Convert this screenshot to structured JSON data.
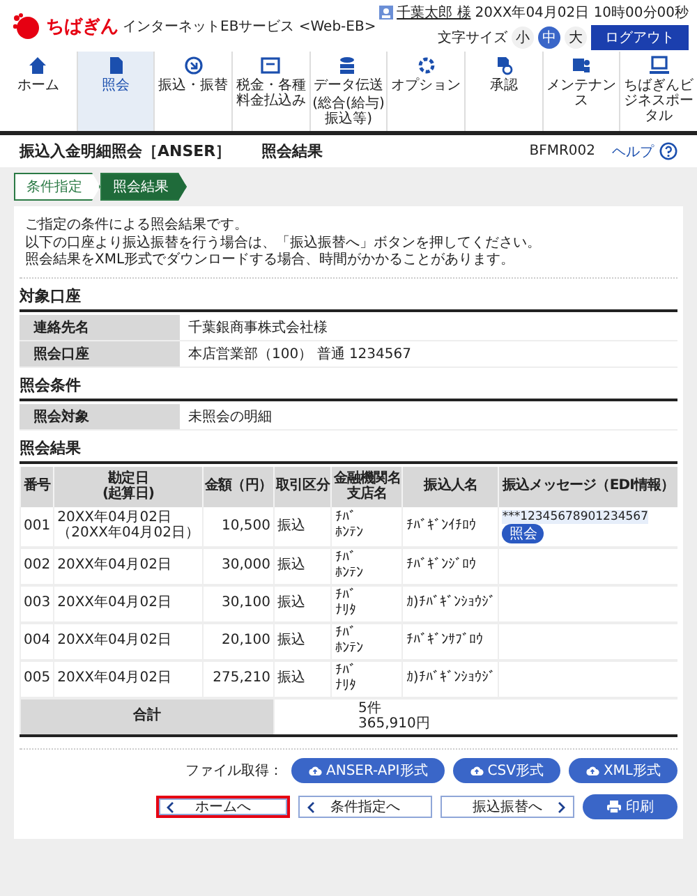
{
  "header": {
    "logo": "ちばぎん",
    "service": "インターネットEBサービス <Web-EB>",
    "user": "千葉太郎 様",
    "datetime": "20XX年04月02日 10時00分00秒",
    "font_size": {
      "label": "文字サイズ",
      "options": [
        {
          "label": "小",
          "selected": false
        },
        {
          "label": "中",
          "selected": true
        },
        {
          "label": "大",
          "selected": false
        }
      ]
    },
    "logout": "ログアウト"
  },
  "nav": [
    {
      "label": "ホーム",
      "selected": false
    },
    {
      "label": "照会",
      "selected": true
    },
    {
      "label": "振込・振替",
      "selected": false
    },
    {
      "label": "税金・各種料金払込み",
      "selected": false
    },
    {
      "label": "データ伝送",
      "sublabel": "(総合(給与)振込等)",
      "selected": false
    },
    {
      "label": "オプション",
      "selected": false
    },
    {
      "label": "承認",
      "selected": false
    },
    {
      "label": "メンテナンス",
      "selected": false
    },
    {
      "label": "ちばぎんビジネスポータル",
      "selected": false
    }
  ],
  "page": {
    "title": "振込入金明細照会［ANSER］",
    "subtitle": "照会結果",
    "screen_id": "BFMR002",
    "help": "ヘルプ"
  },
  "steps": [
    {
      "label": "条件指定",
      "selected": false
    },
    {
      "label": "照会結果",
      "selected": true
    }
  ],
  "intro": [
    "ご指定の条件による照会結果です。",
    "以下の口座より振込振替を行う場合は、「振込振替へ」ボタンを押してください。",
    "照会結果をXML形式でダウンロードする場合、時間がかかることがあります。"
  ],
  "target_account": {
    "title": "対象口座",
    "rows": [
      {
        "label": "連絡先名",
        "value": "千葉銀商事株式会社様"
      },
      {
        "label": "照会口座",
        "value": "本店営業部（100） 普通 1234567"
      }
    ]
  },
  "conditions": {
    "title": "照会条件",
    "rows": [
      {
        "label": "照会対象",
        "value": "未照会の明細"
      }
    ]
  },
  "results": {
    "title": "照会結果",
    "columns": [
      [
        "番号"
      ],
      [
        "勘定日",
        "(起算日)"
      ],
      [
        "金額（円）"
      ],
      [
        "取引区分"
      ],
      [
        "金融機関名",
        "支店名"
      ],
      [
        "振込人名"
      ],
      [
        "振込メッセージ（EDI情報）"
      ]
    ],
    "rows": [
      {
        "no": "001",
        "date": "20XX年04月02日",
        "date_sub": "（20XX年04月02日）",
        "amount": "10,500",
        "type": "振込",
        "bank": "ﾁﾊﾞ",
        "branch": "ﾎﾝﾃﾝ",
        "payer": "ﾁﾊﾞｷﾞﾝｲﾁﾛｳ",
        "message": "***12345678901234567",
        "message_button": "照会"
      },
      {
        "no": "002",
        "date": "20XX年04月02日",
        "amount": "30,000",
        "type": "振込",
        "bank": "ﾁﾊﾞ",
        "branch": "ﾎﾝﾃﾝ",
        "payer": "ﾁﾊﾞｷﾞﾝｼﾞﾛｳ"
      },
      {
        "no": "003",
        "date": "20XX年04月02日",
        "amount": "30,100",
        "type": "振込",
        "bank": "ﾁﾊﾞ",
        "branch": "ﾅﾘﾀ",
        "payer": "ｶ)ﾁﾊﾞｷﾞﾝｼｮｳｼﾞ"
      },
      {
        "no": "004",
        "date": "20XX年04月02日",
        "amount": "20,100",
        "type": "振込",
        "bank": "ﾁﾊﾞ",
        "branch": "ﾎﾝﾃﾝ",
        "payer": "ﾁﾊﾞｷﾞﾝｻﾌﾞﾛｳ"
      },
      {
        "no": "005",
        "date": "20XX年04月02日",
        "amount": "275,210",
        "type": "振込",
        "bank": "ﾁﾊﾞ",
        "branch": "ﾅﾘﾀ",
        "payer": "ｶ)ﾁﾊﾞｷﾞﾝｼｮｳｼﾞ"
      }
    ],
    "total": {
      "label": "合計",
      "count": "5件",
      "amount": "365,910円"
    }
  },
  "file_download": {
    "label": "ファイル取得：",
    "buttons": [
      "ANSER-API形式",
      "CSV形式",
      "XML形式"
    ]
  },
  "actions": [
    {
      "label": "ホームへ",
      "kind": "back",
      "highlighted": true
    },
    {
      "label": "条件指定へ",
      "kind": "back",
      "highlighted": false
    },
    {
      "label": "振込振替へ",
      "kind": "forward",
      "highlighted": false
    },
    {
      "label": "印刷",
      "kind": "print",
      "highlighted": false
    }
  ]
}
